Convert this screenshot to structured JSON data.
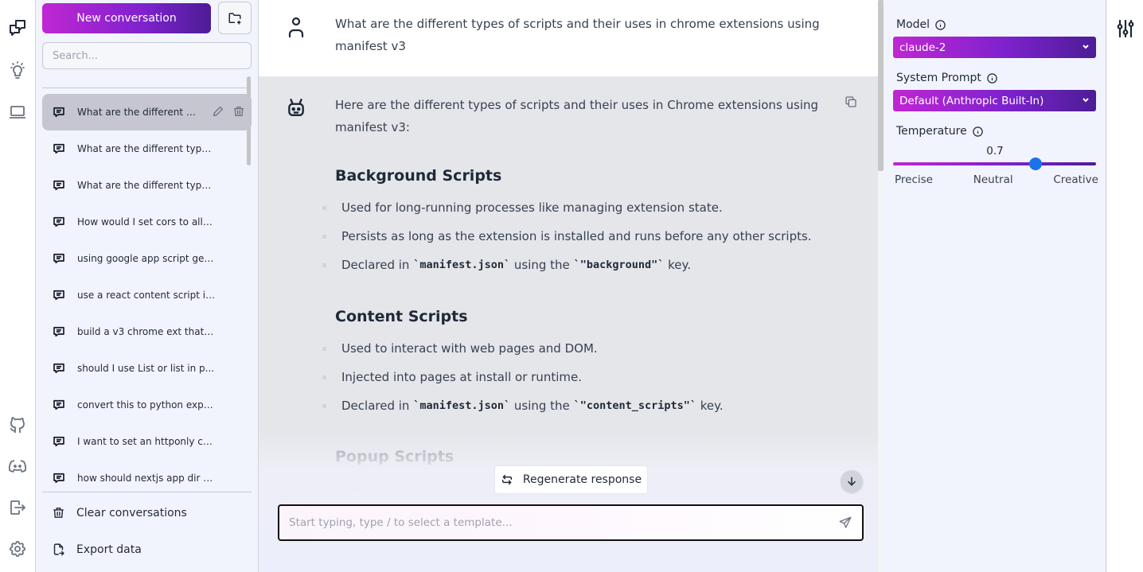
{
  "rail": {
    "icons": [
      "conversations-icon",
      "prompts-icon",
      "laptop-icon",
      "github-icon",
      "discord-icon",
      "logout-icon",
      "settings-icon"
    ]
  },
  "sidebar": {
    "new_conversation_label": "New conversation",
    "search_placeholder": "Search...",
    "search_value": "",
    "conversations": [
      {
        "label": "What are the different types of scripts and their uses in chrome extensions using manifest v3",
        "display": "What are the different ty…",
        "active": true
      },
      {
        "label": "What are the different types o...",
        "active": false
      },
      {
        "label": "What are the different types o...",
        "active": false
      },
      {
        "label": "How would I set cors to allow ...",
        "active": false
      },
      {
        "label": "using google app script get th...",
        "active": false
      },
      {
        "label": "use a react content script in ...",
        "active": false
      },
      {
        "label": "build a v3 chrome ext that aut...",
        "active": false
      },
      {
        "label": "should I use List or list in p...",
        "active": false
      },
      {
        "label": "convert this to python export...",
        "active": false
      },
      {
        "label": "I want to set an httponly cook...",
        "active": false
      },
      {
        "label": "how should nextjs app dir be s...",
        "active": false
      }
    ],
    "footer": {
      "clear_label": "Clear conversations",
      "export_label": "Export data"
    }
  },
  "chat": {
    "user_message": "What are the different types of scripts and their uses in chrome extensions using manifest v3",
    "assistant_intro": "Here are the different types of scripts and their uses in Chrome extensions using manifest v3:",
    "sections": [
      {
        "heading": "Background Scripts",
        "bullets": [
          {
            "text": "Used for long-running processes like managing extension state."
          },
          {
            "text": "Persists as long as the extension is installed and runs before any other scripts."
          },
          {
            "pre": "Declared in ",
            "code1": "`manifest.json`",
            "mid": " using the ",
            "code2": "`\"background\"`",
            "post": " key."
          }
        ]
      },
      {
        "heading": "Content Scripts",
        "bullets": [
          {
            "text": "Used to interact with web pages and DOM."
          },
          {
            "text": "Injected into pages at install or runtime."
          },
          {
            "pre": "Declared in ",
            "code1": "`manifest.json`",
            "mid": " using the ",
            "code2": "`\"content_scripts\"`",
            "post": " key."
          }
        ]
      },
      {
        "heading": "Popup Scripts",
        "bullets": [
          {
            "text": "Used for popup pages a..."
          }
        ]
      }
    ],
    "regenerate_label": "Regenerate response",
    "input_placeholder": "Start typing, type / to select a template...",
    "input_value": ""
  },
  "settings": {
    "model_label": "Model",
    "model_value": "claude-2",
    "system_prompt_label": "System Prompt",
    "system_prompt_value": "Default (Anthropic Built-In)",
    "temperature_label": "Temperature",
    "temperature_value": "0.7",
    "temperature_fraction": 0.7,
    "temperature_labels": [
      "Precise",
      "Neutral",
      "Creative"
    ]
  },
  "colors": {
    "accent_gradient_start": "#c026d3",
    "accent_gradient_end": "#4c1d95",
    "slider_thumb": "#1a73e8"
  }
}
